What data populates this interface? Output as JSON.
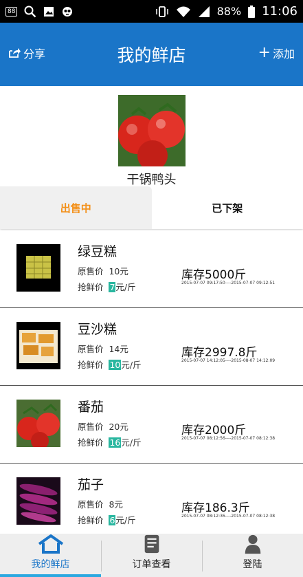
{
  "status_bar": {
    "badge": "88",
    "battery": "88%",
    "time": "11:06"
  },
  "header": {
    "share_label": "分享",
    "title": "我的鲜店",
    "add_label": "添加"
  },
  "shop": {
    "name": "干锅鸭头"
  },
  "tabs": [
    {
      "label": "出售中",
      "active": true
    },
    {
      "label": "已下架",
      "active": false
    }
  ],
  "products": [
    {
      "name": "绿豆糕",
      "orig_label": "原售价",
      "orig_price": "10元",
      "sale_label": "抢鲜价",
      "sale_price": "7",
      "sale_unit": "元/斤",
      "stock": "库存5000斤",
      "time_range": "2015-07-07 09:17:50----2015-07-07 09:12:51",
      "thumb": "mung-bean-cake"
    },
    {
      "name": "豆沙糕",
      "orig_label": "原售价",
      "orig_price": "14元",
      "sale_label": "抢鲜价",
      "sale_price": "10",
      "sale_unit": "元/斤",
      "stock": "库存2997.8斤",
      "time_range": "2015-07-07 14:12:05----2015-08-07 14:12:09",
      "thumb": "red-bean-cake"
    },
    {
      "name": "番茄",
      "orig_label": "原售价",
      "orig_price": "20元",
      "sale_label": "抢鲜价",
      "sale_price": "16",
      "sale_unit": "元/斤",
      "stock": "库存2000斤",
      "time_range": "2015-07-07 08:12:56----2015-07-07 08:12:38",
      "thumb": "tomato"
    },
    {
      "name": "茄子",
      "orig_label": "原售价",
      "orig_price": "8元",
      "sale_label": "抢鲜价",
      "sale_price": "6",
      "sale_unit": "元/斤",
      "stock": "库存186.3斤",
      "time_range": "2015-07-07 08:12:36----2015-07-07 08:12:38",
      "thumb": "eggplant"
    }
  ],
  "bottom_nav": [
    {
      "label": "我的鲜店",
      "icon": "home-icon",
      "active": true
    },
    {
      "label": "订单查看",
      "icon": "document-icon",
      "active": false
    },
    {
      "label": "登陆",
      "icon": "user-icon",
      "active": false
    }
  ],
  "colors": {
    "primary": "#1a75c8",
    "accent": "#f39019",
    "price_badge": "#2ab7a0",
    "nav_active_bar": "#2aa8e0"
  }
}
